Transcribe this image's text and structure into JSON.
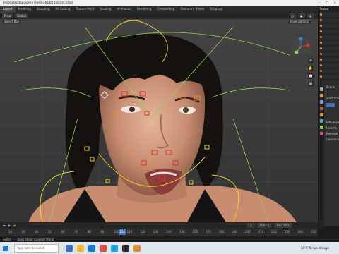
{
  "window": {
    "title": "Jmore\\Desktop\\Scene File\\BLENDER sources.blend",
    "controls": [
      "–",
      "□",
      "×"
    ]
  },
  "workspaces": [
    "Layout",
    "Modeling",
    "Sculpting",
    "UV Editing",
    "Texture Paint",
    "Shading",
    "Animation",
    "Rendering",
    "Compositing",
    "Geometry Nodes",
    "Scripting"
  ],
  "active_workspace": "Layout",
  "header": {
    "mode": "Pose",
    "transform_orientation": "Global",
    "select_box": "Select Box",
    "pose_options": "Pose Options"
  },
  "outliner": {
    "title": "Scene",
    "items": [
      "",
      "",
      "",
      "",
      "",
      "",
      "",
      "",
      "",
      "",
      "",
      ""
    ]
  },
  "properties": {
    "rows": [
      "Scene",
      "",
      "Subframe",
      "",
      "",
      "Influence",
      "Hide Pa",
      "Remove",
      "Coordinate"
    ]
  },
  "timeline": {
    "ticks": [
      "10",
      "20",
      "40",
      "50",
      "60",
      "70",
      "80",
      "90",
      "100",
      "110",
      "120",
      "130",
      "140",
      "150",
      "160",
      "170",
      "180",
      "190",
      "200",
      "210",
      "220",
      "230",
      "240",
      "250"
    ],
    "current_frame": "124",
    "start_label": "Start",
    "start_value": "1",
    "end_label": "End",
    "end_value": "250",
    "frame_box": "1"
  },
  "statusbar": {
    "items": [
      "Select",
      "Drag Shear Context Menu"
    ]
  },
  "taskbar": {
    "search_placeholder": "Type here to search",
    "weather": "10°C Temps dégagé",
    "time": ""
  },
  "colors": {
    "accent": "#4772b3",
    "rig_yellow": "#e9d12a",
    "rig_green": "#8fd14f",
    "rig_red": "#d6362e",
    "rig_orange": "#e8892b"
  }
}
